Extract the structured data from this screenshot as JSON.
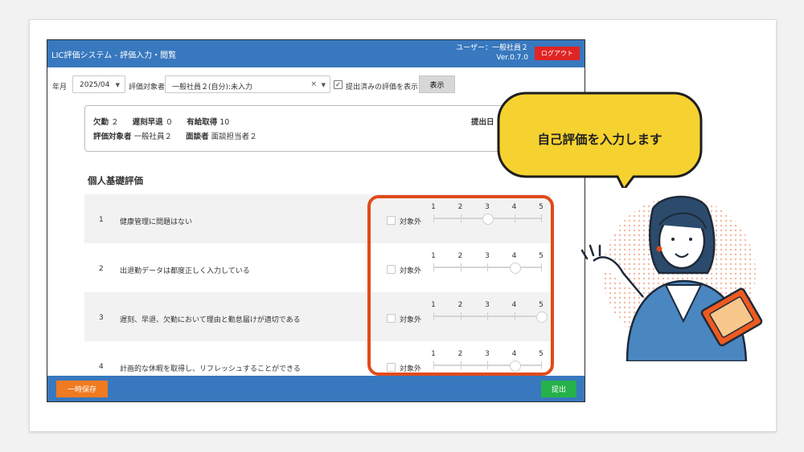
{
  "header": {
    "title": "LIC評価システム - 評価入力・閲覧",
    "user": "ユーザー：一般社員２",
    "version": "Ver.0.7.0",
    "logout": "ログアウト"
  },
  "filter": {
    "month_label": "年月",
    "month_value": "2025/04",
    "target_label": "評価対象者",
    "target_value": "一般社員２(自分):未入力",
    "clear_symbol": "×",
    "show_submitted_label": "提出済みの評価を表示",
    "show_submitted_checked": true,
    "show_button": "表示"
  },
  "info": {
    "absence_label": "欠勤",
    "absence_value": "２",
    "late_label": "遅刻早退",
    "late_value": "０",
    "leave_label": "有給取得",
    "leave_value": "10",
    "submit_date_label": "提出日",
    "submit_date_value": "ー",
    "target_label": "評価対象者",
    "target_value": "一般社員２",
    "interviewer_label": "面談者",
    "interviewer_value": "面談担当者２"
  },
  "section_title": "個人基礎評価",
  "scale_labels": [
    "1",
    "2",
    "3",
    "4",
    "5"
  ],
  "na_label": "対象外",
  "evaluations": [
    {
      "num": "1",
      "text": "健康管理に問題はない",
      "value": 3
    },
    {
      "num": "2",
      "text": "出退勤データは都度正しく入力している",
      "value": 4
    },
    {
      "num": "3",
      "text": "遅刻、早退、欠勤において理由と勤怠届けが適切である",
      "value": 5
    },
    {
      "num": "4",
      "text": "計画的な休暇を取得し、リフレッシュすることができる",
      "value": 4
    }
  ],
  "footer": {
    "save": "一時保存",
    "submit": "提出"
  },
  "callout": "自己評価を入力します",
  "colors": {
    "header": "#3878be",
    "logout": "#e02424",
    "save": "#f07a20",
    "submit": "#25b14a",
    "highlight": "#e14a1a",
    "bubble": "#f5d22f"
  }
}
